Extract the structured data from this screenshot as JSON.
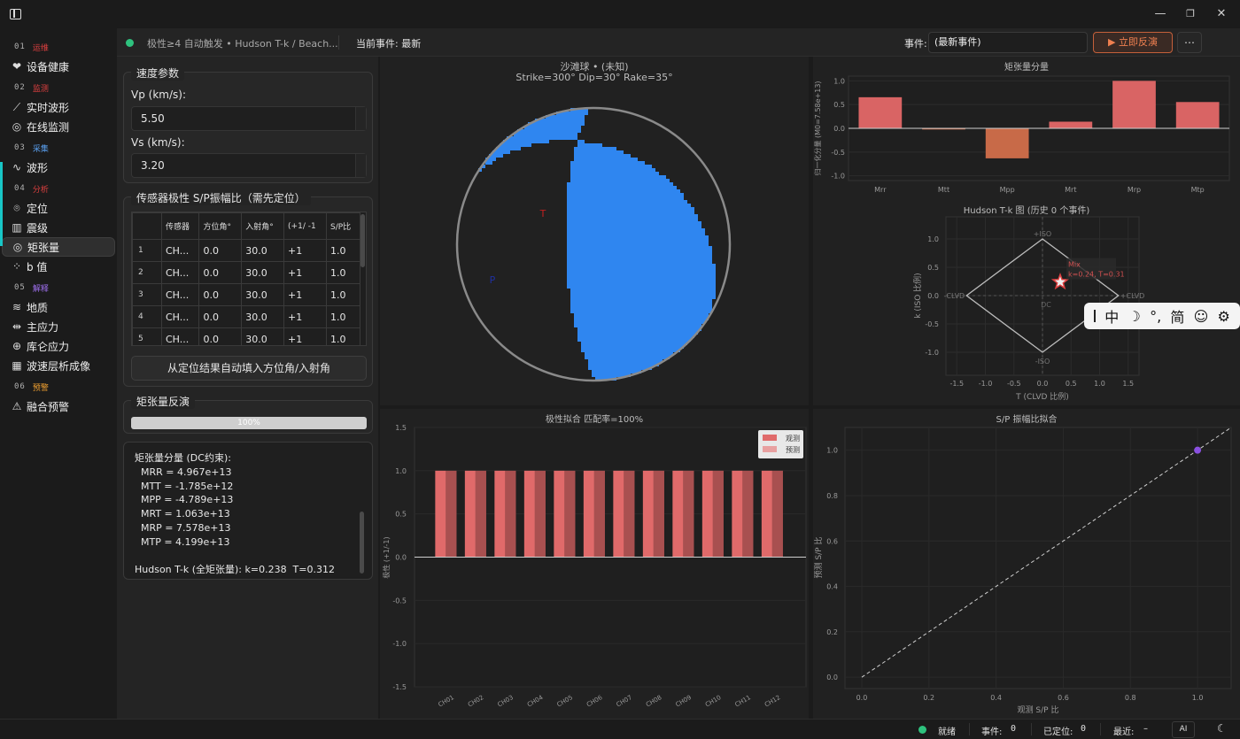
{
  "window": {
    "minimize_glyph": "—",
    "maximize_glyph": "❐",
    "close_glyph": "✕",
    "sidebar_toggle_icon": "sidebar-toggle-icon"
  },
  "sidebar": {
    "sections": [
      {
        "num": "01",
        "label": "运维",
        "color": "#e04040",
        "items": [
          {
            "icon": "heart-pulse-icon",
            "glyph": "❤",
            "label": "设备健康"
          }
        ]
      },
      {
        "num": "02",
        "label": "监测",
        "color": "#e04040",
        "items": [
          {
            "icon": "line-chart-icon",
            "glyph": "⟋",
            "label": "实时波形"
          },
          {
            "icon": "radar-icon",
            "glyph": "◎",
            "label": "在线监测"
          }
        ]
      },
      {
        "num": "03",
        "label": "采集",
        "color": "#5aa0f0",
        "items": [
          {
            "icon": "wave-icon",
            "glyph": "∿",
            "label": "波形"
          }
        ]
      },
      {
        "num": "04",
        "label": "分析",
        "color": "#e04040",
        "items": [
          {
            "icon": "map-pin-icon",
            "glyph": "⌾",
            "label": "定位"
          },
          {
            "icon": "bar-chart-icon",
            "glyph": "▥",
            "label": "震级"
          },
          {
            "icon": "target-icon",
            "glyph": "◎",
            "label": "矩张量",
            "active": true
          },
          {
            "icon": "scatter-icon",
            "glyph": "⁘",
            "label": "b 值"
          }
        ]
      },
      {
        "num": "05",
        "label": "解释",
        "color": "#a070f0",
        "items": [
          {
            "icon": "layers-icon",
            "glyph": "≋",
            "label": "地质"
          },
          {
            "icon": "stress-icon",
            "glyph": "⇹",
            "label": "主应力"
          },
          {
            "icon": "crosshair-icon",
            "glyph": "⊕",
            "label": "库仑应力"
          },
          {
            "icon": "grid-icon",
            "glyph": "▦",
            "label": "波速层析成像"
          }
        ]
      },
      {
        "num": "06",
        "label": "预警",
        "color": "#f0a030",
        "items": [
          {
            "icon": "warning-icon",
            "glyph": "⚠",
            "label": "融合预警"
          }
        ]
      }
    ]
  },
  "topbar": {
    "status_dot_color": "#2ec27e",
    "mode_text": "极性≥4 自动触发 • Hudson T-k / Beach...",
    "current_event_label": "当前事件: 最新",
    "event_label": "事件:",
    "event_value": "(最新事件)",
    "run_button": "▶ 立即反演",
    "more_button": "⋯"
  },
  "velocity": {
    "title": "速度参数",
    "vp_label": "Vp (km/s):",
    "vp_value": "5.50",
    "vs_label": "Vs (km/s):",
    "vs_value": "3.20"
  },
  "sensors": {
    "title": "传感器极性 S/P振幅比（需先定位）",
    "headers": [
      "",
      "传感器",
      "方位角°",
      "入射角°",
      "(+1/ -1",
      "S/P比"
    ],
    "rows": [
      [
        "1",
        "CH...",
        "0.0",
        "30.0",
        "+1",
        "1.0"
      ],
      [
        "2",
        "CH...",
        "0.0",
        "30.0",
        "+1",
        "1.0"
      ],
      [
        "3",
        "CH...",
        "0.0",
        "30.0",
        "+1",
        "1.0"
      ],
      [
        "4",
        "CH...",
        "0.0",
        "30.0",
        "+1",
        "1.0"
      ],
      [
        "5",
        "CH...",
        "0.0",
        "30.0",
        "+1",
        "1.0"
      ]
    ],
    "autofill_button": "从定位结果自动填入方位角/入射角"
  },
  "inversion": {
    "title": "矩张量反演",
    "progress_value": 100,
    "progress_text": "100%"
  },
  "results": {
    "lines": [
      "矩张量分量 (DC约束):",
      "  MRR = 4.967e+13",
      "  MTT = -1.785e+12",
      "  MPP = -4.789e+13",
      "  MRT = 1.063e+13",
      "  MRP = 7.578e+13",
      "  MTP = 4.199e+13",
      "",
      "Hudson T-k (全矩张量): k=0.238  T=0.312"
    ]
  },
  "beachball": {
    "title": "沙滩球 • (未知)",
    "subtitle": "Strike=300° Dip=30° Rake=35°",
    "t_label": "T",
    "p_label": "P",
    "strike": 300,
    "dip": 30,
    "rake": 35,
    "compression_color": "#2f86f0",
    "dilatation_color": "#191919"
  },
  "mt_bars": {
    "title": "矩张量分量",
    "ylabel": "归一化分量 (M0=7.58e+13)",
    "categories": [
      "Mrr",
      "Mtt",
      "Mpp",
      "Mrt",
      "Mrp",
      "Mtp"
    ],
    "values": [
      0.655,
      -0.024,
      -0.632,
      0.14,
      1.0,
      0.554
    ],
    "yticks": [
      "1.0",
      "0.5",
      "0.0",
      "-0.5",
      "-1.0"
    ],
    "ylim": [
      -1.1,
      1.1
    ]
  },
  "hudson": {
    "title": "Hudson T-k 图 (历史 0 个事件)",
    "xlabel": "T (CLVD 比例)",
    "ylabel": "k (ISO 比例)",
    "xticks": [
      "-1.5",
      "-1.0",
      "-0.5",
      "0.0",
      "0.5",
      "1.0",
      "1.5"
    ],
    "yticks": [
      "1.0",
      "0.5",
      "0.0",
      "-0.5",
      "-1.0"
    ],
    "labels": {
      "iso_plus": "+ISO",
      "iso_minus": "-ISO",
      "clvd_plus": "+CLVD",
      "clvd_minus": "-CLVD",
      "dc": "DC"
    },
    "point": {
      "T": 0.31,
      "k": 0.24
    },
    "annotation_title": "Mix",
    "annotation_text": "k=0.24, T=0.31"
  },
  "polarity": {
    "title": "极性拟合  匹配率=100%",
    "ylabel": "极性 (+1/-1)",
    "legend": [
      "观测",
      "预测"
    ],
    "categories": [
      "CH01",
      "CH02",
      "CH03",
      "CH04",
      "CH05",
      "CH06",
      "CH07",
      "CH08",
      "CH09",
      "CH10",
      "CH11",
      "CH12"
    ],
    "observed": [
      1,
      1,
      1,
      1,
      1,
      1,
      1,
      1,
      1,
      1,
      1,
      1
    ],
    "predicted": [
      1,
      1,
      1,
      1,
      1,
      1,
      1,
      1,
      1,
      1,
      1,
      1
    ],
    "yticks": [
      "1.5",
      "1.0",
      "0.5",
      "0.0",
      "-0.5",
      "-1.0",
      "-1.5"
    ],
    "ylim": [
      -1.5,
      1.5
    ],
    "obs_color": "#e06a6a",
    "pred_color": "#a85050"
  },
  "sp_fit": {
    "title": "S/P 振幅比拟合",
    "xlabel": "观测 S/P 比",
    "ylabel": "预测 S/P 比",
    "xticks": [
      "0.0",
      "0.2",
      "0.4",
      "0.6",
      "0.8",
      "1.0"
    ],
    "yticks": [
      "1.0",
      "0.8",
      "0.6",
      "0.4",
      "0.2",
      "0.0"
    ],
    "points": [
      {
        "x": 1.0,
        "y": 1.0
      }
    ],
    "xlim": [
      -0.05,
      1.1
    ],
    "ylim": [
      -0.05,
      1.1
    ]
  },
  "ime": {
    "items": [
      "中",
      "☽",
      "°,",
      "简",
      "☺",
      "⚙"
    ]
  },
  "statusbar": {
    "ready": "就绪",
    "events_label": "事件:",
    "events_value": "0",
    "located_label": "已定位:",
    "located_value": "0",
    "recent_label": "最近:",
    "recent_value": "–",
    "ai_button": "AI",
    "theme_icon": "☾"
  }
}
